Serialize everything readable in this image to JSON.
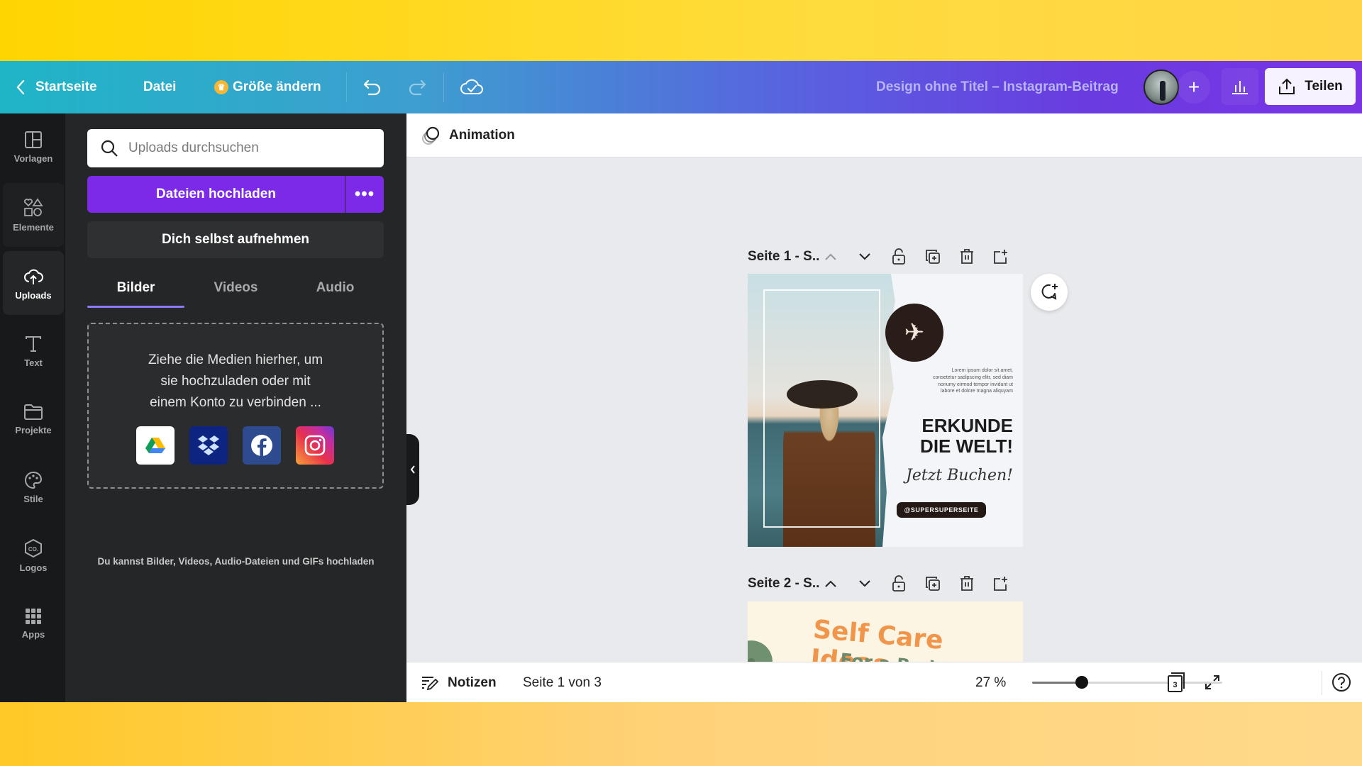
{
  "header": {
    "back_label": "Startseite",
    "file_label": "Datei",
    "resize_label": "Größe ändern",
    "doc_title": "Design ohne Titel – Instagram-Beitrag",
    "share_label": "Teilen",
    "add_member_label": "+"
  },
  "rail": {
    "items": [
      {
        "label": "Vorlagen",
        "icon": "templates-icon"
      },
      {
        "label": "Elemente",
        "icon": "elements-icon"
      },
      {
        "label": "Uploads",
        "icon": "upload-cloud-icon",
        "active": true
      },
      {
        "label": "Text",
        "icon": "text-icon"
      },
      {
        "label": "Projekte",
        "icon": "folder-icon"
      },
      {
        "label": "Stile",
        "icon": "palette-icon"
      },
      {
        "label": "Logos",
        "icon": "logo-icon"
      },
      {
        "label": "Apps",
        "icon": "apps-grid-icon"
      }
    ]
  },
  "panel": {
    "search_placeholder": "Uploads durchsuchen",
    "upload_label": "Dateien hochladen",
    "more_label": "•••",
    "record_label": "Dich selbst aufnehmen",
    "tabs": [
      {
        "label": "Bilder",
        "active": true
      },
      {
        "label": "Videos"
      },
      {
        "label": "Audio"
      }
    ],
    "drop_text": [
      "Ziehe die Medien hierher, um",
      "sie hochzuladen oder mit",
      "einem Konto zu verbinden ..."
    ],
    "services": [
      "Google Drive",
      "Dropbox",
      "Facebook",
      "Instagram"
    ],
    "hint": "Du kannst Bilder, Videos, Audio-Dateien und GIFs hochladen"
  },
  "editor": {
    "animation_label": "Animation",
    "pages": [
      {
        "title": "Seite 1 - S..",
        "lorem": "Lorem ipsum dolor sit amet, consetetur sadipscing elitr, sed diam nonumy eirmod tempor invidunt ut labore et dolore magna aliquyam",
        "headline_1": "ERKUNDE",
        "headline_2": "DIE WELT!",
        "script": "Jetzt Buchen!",
        "handle": "@SUPERSUPERSEITE"
      },
      {
        "title": "Seite 2 - S..",
        "headline": "Self Care Ideas",
        "subline": "For a Bad Day"
      }
    ]
  },
  "footer": {
    "notes_label": "Notizen",
    "page_count": "Seite 1 von 3",
    "zoom": "27 %",
    "zoom_fraction": 0.26,
    "pages_badge": "3"
  }
}
